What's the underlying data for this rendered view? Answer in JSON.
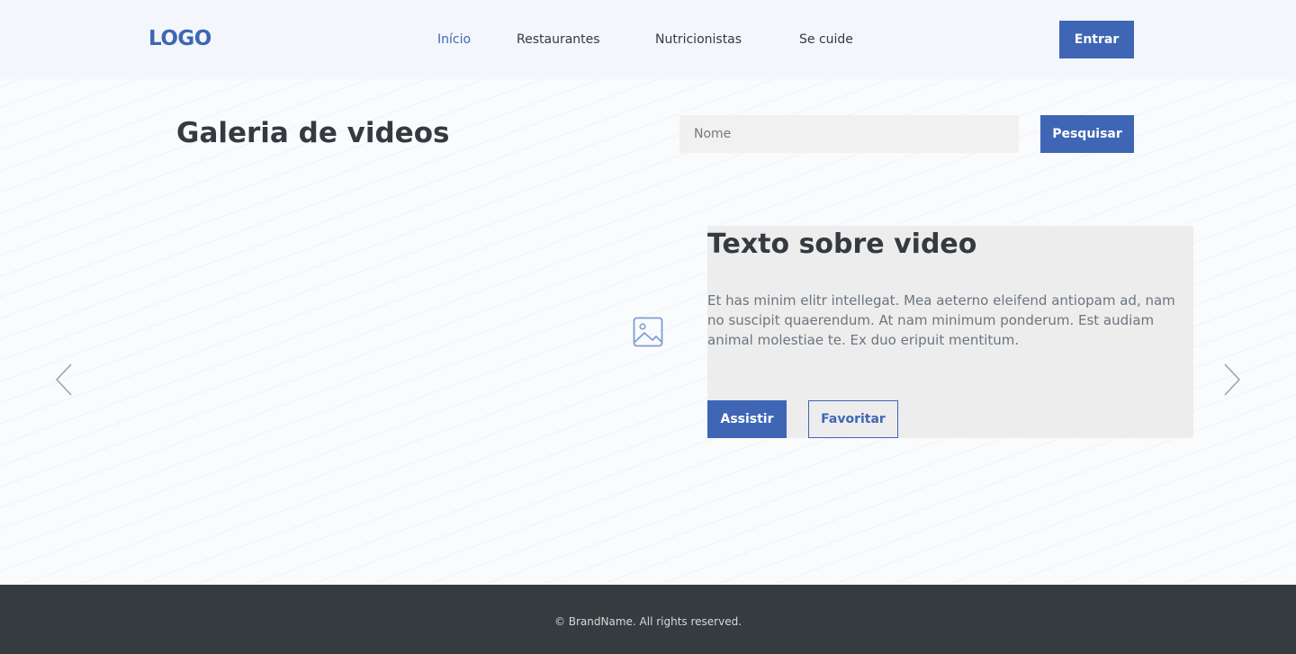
{
  "header": {
    "logo": "LOGO",
    "nav": [
      {
        "label": "Início",
        "active": true
      },
      {
        "label": "Restaurantes",
        "active": false
      },
      {
        "label": "Nutricionistas",
        "active": false
      },
      {
        "label": "Se cuide",
        "active": false
      }
    ],
    "login_label": "Entrar"
  },
  "main": {
    "title": "Galeria de videos",
    "search": {
      "placeholder": "Nome",
      "value": "",
      "button_label": "Pesquisar"
    },
    "slide": {
      "media_icon": "image-icon",
      "title": "Texto sobre video",
      "text": "Et has minim elitr intellegat. Mea aeterno eleifend antiopam ad, nam no suscipit quaerendum. At nam minimum ponderum. Est audiam animal molestiae te. Ex duo eripuit mentitum.",
      "watch_label": "Assistir",
      "favorite_label": "Favoritar"
    },
    "carousel": {
      "prev_icon": "chevron-left-icon",
      "next_icon": "chevron-right-icon"
    }
  },
  "footer": {
    "copyright": "© BrandName. All rights reserved."
  },
  "colors": {
    "accent": "#3e66b5",
    "header_bg": "#f3f6fa",
    "footer_bg": "#353c3f",
    "text_dark": "#343a40",
    "text_muted": "#6c757d"
  }
}
